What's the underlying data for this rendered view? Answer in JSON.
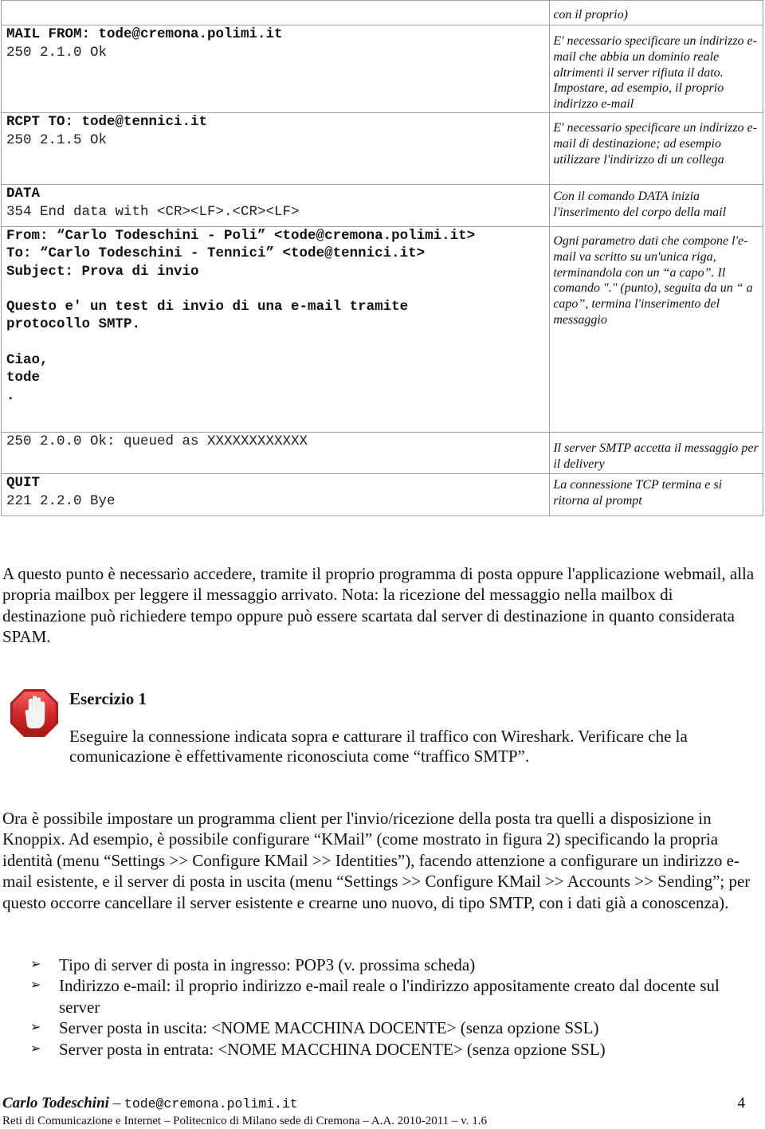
{
  "smtp_table": {
    "rows": [
      {
        "id": "continuation",
        "lines": [],
        "note": "con il proprio)"
      },
      {
        "id": "mail-from",
        "command": "MAIL FROM: tode@cremona.polimi.it",
        "response": "250 2.1.0 Ok",
        "note": "E' necessario specificare un indirizzo e-mail che abbia un dominio reale altrimenti il server rifiuta il dato. Impostare, ad esempio, il proprio indirizzo e-mail"
      },
      {
        "id": "rcpt-to",
        "command": "RCPT TO: tode@tennici.it",
        "response": "250 2.1.5 Ok",
        "note": "E' necessario specificare un indirizzo e-mail di destinazione; ad esempio utilizzare l'indirizzo di un collega"
      },
      {
        "id": "data",
        "command": "DATA",
        "response": "354 End data with <CR><LF>.<CR><LF>",
        "note": "Con il comando DATA inizia l'inserimento del corpo della mail"
      },
      {
        "id": "message-body",
        "body_lines": [
          "From: “Carlo Todeschini - Poli” <tode@cremona.polimi.it>",
          "To: “Carlo Todeschini - Tennici” <tode@tennici.it>",
          "Subject: Prova di invio",
          "",
          "Questo e' un test di invio di una e-mail tramite",
          "protocollo SMTP.",
          "",
          "Ciao,",
          "tode",
          "."
        ],
        "note": "Ogni parametro dati che compone l'e-mail va scritto su un'unica riga, terminandola con un “a capo”. Il comando \".\" (punto), seguita da un “ a capo”, termina l'inserimento del messaggio"
      },
      {
        "id": "queued",
        "response": "250 2.0.0 Ok: queued as XXXXXXXXXXXX",
        "note": "Il server SMTP accetta il messaggio per il delivery"
      },
      {
        "id": "quit",
        "command": "QUIT",
        "response": "221 2.2.0 Bye",
        "note": "La connessione TCP termina e si ritorna al prompt"
      }
    ]
  },
  "paragraph_1": "A questo punto è necessario accedere, tramite il proprio programma di posta oppure l'applicazione webmail, alla propria mailbox per leggere il messaggio arrivato. Nota: la ricezione del messaggio nella mailbox di destinazione può richiedere tempo oppure può essere scartata dal server di destinazione in quanto considerata SPAM.",
  "exercise": {
    "icon": "stop-hand-icon",
    "title": "Esercizio 1",
    "text": "Eseguire la connessione indicata sopra e catturare il traffico con Wireshark. Verificare che la comunicazione è effettivamente riconosciuta come “traffico SMTP”."
  },
  "paragraph_2": "Ora è possibile impostare un programma client per l'invio/ricezione della posta tra quelli a disposizione in Knoppix. Ad esempio, è possibile configurare “KMail” (come mostrato in figura 2) specificando la propria identità (menu “Settings >> Configure KMail >> Identities”), facendo attenzione a configurare un indirizzo e-mail esistente, e il server di posta in uscita (menu “Settings >> Configure KMail >> Accounts >> Sending”; per questo occorre cancellare il server esistente e crearne uno nuovo, di tipo SMTP, con i dati già a conoscenza).",
  "bullets": {
    "marker": "➢",
    "items": [
      "Tipo di server di posta in ingresso: POP3 (v. prossima scheda)",
      "Indirizzo e-mail: il proprio indirizzo e-mail reale o l'indirizzo appositamente creato dal docente sul server",
      "Server posta in uscita: <NOME MACCHINA DOCENTE> (senza opzione SSL)",
      "Server posta in entrata: <NOME MACCHINA DOCENTE> (senza opzione SSL)"
    ]
  },
  "footer": {
    "author": "Carlo Todeschini",
    "separator": " – ",
    "email": "tode@cremona.polimi.it",
    "page_number": "4",
    "course": "Reti di Comunicazione e Internet – Politecnico di Milano sede di Cremona – A.A. 2010-2011 – v. 1.6"
  },
  "colors": {
    "table_border": "#a0a0a0",
    "stop_icon_red": "#d42a2a",
    "text": "#111111"
  }
}
